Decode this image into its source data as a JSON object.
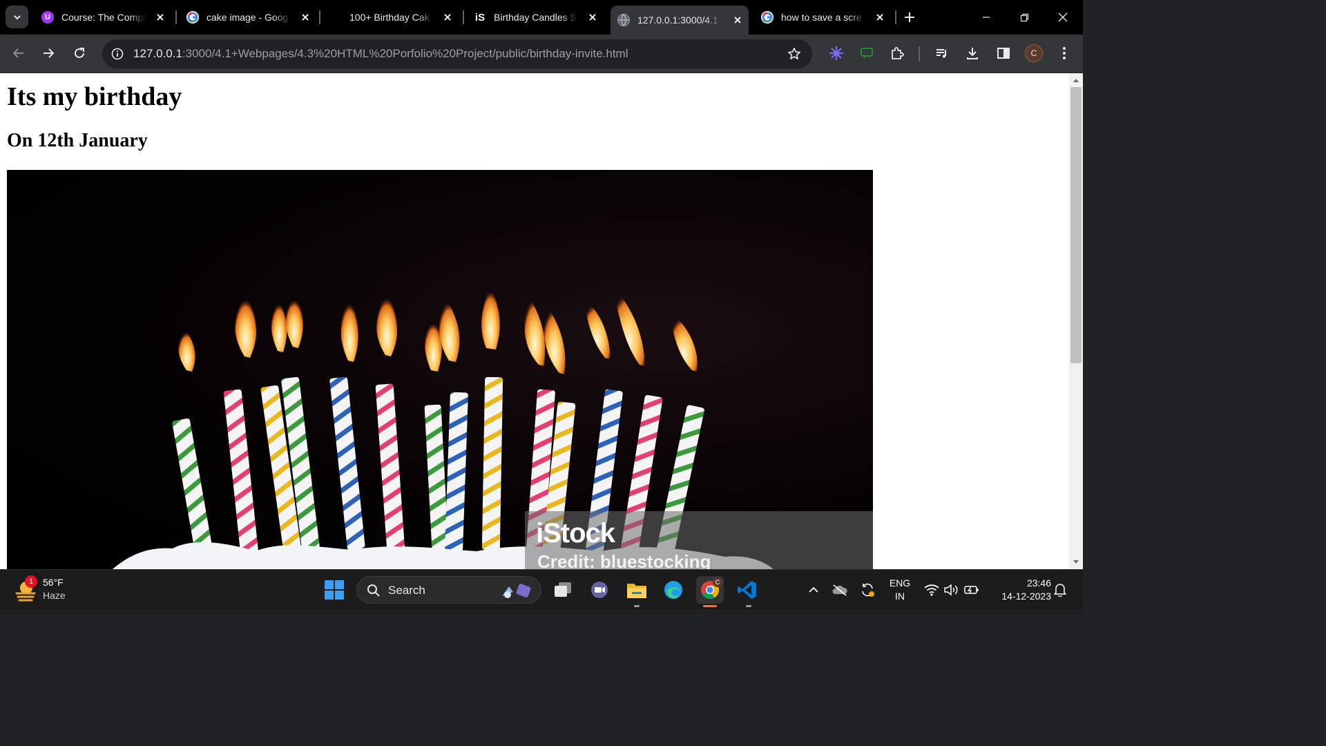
{
  "browser": {
    "tabs": [
      {
        "title": "Course: The Compl",
        "favicon": "udemy-icon",
        "active": false
      },
      {
        "title": "cake image - Goog",
        "favicon": "google-icon",
        "active": false
      },
      {
        "title": "100+ Birthday Cak",
        "favicon": "",
        "active": false
      },
      {
        "title": "Birthday Candles S",
        "favicon": "istock-icon",
        "active": false
      },
      {
        "title": "127.0.0.1:3000/4.1",
        "favicon": "globe-icon",
        "active": true
      },
      {
        "title": "how to save a scre",
        "favicon": "google-icon",
        "active": false
      }
    ],
    "istock_favicon_text": "iS",
    "url_host": "127.0.0.1",
    "url_rest": ":3000/4.1+Webpages/4.3%20HTML%20Porfolio%20Project/public/birthday-invite.html",
    "profile_initial": "C"
  },
  "page": {
    "heading": "Its my birthday",
    "subheading": "On 12th January",
    "image": {
      "watermark_logo": "iStock",
      "watermark_credit": "Credit: bluestocking"
    }
  },
  "taskbar": {
    "weather": {
      "temp": "56°F",
      "condition": "Haze",
      "badge": "1"
    },
    "search_label": "Search",
    "language": "ENG",
    "region": "IN",
    "time": "23:46",
    "date": "14-12-2023",
    "chrome_badge": "C"
  },
  "colors": {
    "chrome_dark": "#35363a",
    "tab_strip": "#000000",
    "taskbar": "#1c1c1c",
    "google_blue": "#4285f4",
    "udemy_purple": "#a435f0",
    "vscode_blue": "#0078d4"
  }
}
